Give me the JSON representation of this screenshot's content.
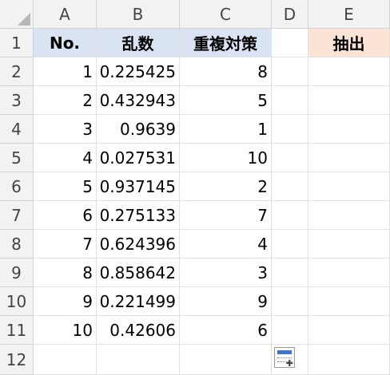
{
  "columns": [
    "A",
    "B",
    "C",
    "D",
    "E"
  ],
  "rows": [
    "1",
    "2",
    "3",
    "4",
    "5",
    "6",
    "7",
    "8",
    "9",
    "10",
    "11",
    "12"
  ],
  "headers": {
    "a": "No.",
    "b": "乱数",
    "c": "重複対策",
    "e": "抽出"
  },
  "data": [
    {
      "a": "1",
      "b": "0.225425",
      "c": "8"
    },
    {
      "a": "2",
      "b": "0.432943",
      "c": "5"
    },
    {
      "a": "3",
      "b": "0.9639",
      "c": "1"
    },
    {
      "a": "4",
      "b": "0.027531",
      "c": "10"
    },
    {
      "a": "5",
      "b": "0.937145",
      "c": "2"
    },
    {
      "a": "6",
      "b": "0.275133",
      "c": "7"
    },
    {
      "a": "7",
      "b": "0.624396",
      "c": "4"
    },
    {
      "a": "8",
      "b": "0.858642",
      "c": "3"
    },
    {
      "a": "9",
      "b": "0.221499",
      "c": "9"
    },
    {
      "a": "10",
      "b": "0.42606",
      "c": "6"
    }
  ],
  "colors": {
    "header_blue": "#dae3f3",
    "header_peach": "#fbe4d5",
    "grid": "#e1e1e1"
  },
  "quick_analysis_icon": "quick-analysis-icon"
}
